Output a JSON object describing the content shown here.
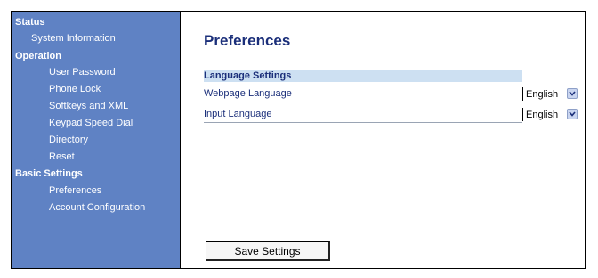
{
  "sidebar": {
    "sections": [
      {
        "label": "Status",
        "items": [
          "System Information"
        ]
      },
      {
        "label": "Operation",
        "items": [
          "User Password",
          "Phone Lock",
          "Softkeys and XML",
          "Keypad Speed Dial",
          "Directory",
          "Reset"
        ]
      },
      {
        "label": "Basic Settings",
        "items": [
          "Preferences",
          "Account Configuration"
        ]
      }
    ]
  },
  "main": {
    "title": "Preferences",
    "section_header": "Language Settings",
    "rows": [
      {
        "label": "Webpage Language",
        "value": "English"
      },
      {
        "label": "Input Language",
        "value": "English"
      }
    ],
    "save_label": "Save Settings"
  },
  "colors": {
    "sidebar_bg": "#5f82c4",
    "title": "#1b2f7a",
    "section_header_bg": "#cde0f2"
  }
}
